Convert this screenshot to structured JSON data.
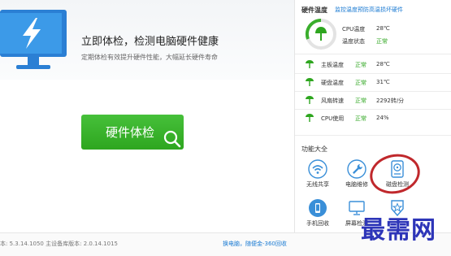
{
  "main": {
    "title": "立即体检，检测电脑硬件健康",
    "subtitle": "定期体检有效提升硬件性能，大幅延长硬件寿命",
    "check_button": "硬件体检"
  },
  "hardware_temp": {
    "title": "硬件温度",
    "link": "监控温度预防高温损坏硬件",
    "gauge_rows": [
      {
        "label": "CPU温度",
        "value": "28℃"
      },
      {
        "label": "温度状态",
        "value": "正常"
      }
    ],
    "rows": [
      {
        "label": "主板温度",
        "status": "正常",
        "value": "28℃"
      },
      {
        "label": "硬盘温度",
        "status": "正常",
        "value": "31℃"
      },
      {
        "label": "风扇转速",
        "status": "正常",
        "value": "2292转/分"
      },
      {
        "label": "CPU使用",
        "status": "正常",
        "value": "24%"
      }
    ]
  },
  "functions": {
    "title": "功能大全",
    "items": [
      {
        "label": "无线共享",
        "icon": "wifi-icon"
      },
      {
        "label": "电脑维修",
        "icon": "wrench-icon"
      },
      {
        "label": "磁盘检测",
        "icon": "disk-icon"
      },
      {
        "label": "手机回收",
        "icon": "phone-recycle-icon"
      },
      {
        "label": "屏幕检测",
        "icon": "monitor-icon"
      },
      {
        "label": "",
        "icon": "star-badge-icon"
      }
    ]
  },
  "status_bar": {
    "version": "本: 5.3.14.1050  主设备库版本: 2.0.14.1015",
    "link": "换电脑，随便金-360回收"
  },
  "watermark": "最需网",
  "colors": {
    "accent": "#2ea61f",
    "link": "#1a7ad2",
    "highlight": "#c0282c",
    "watermark": "#2d35b8"
  }
}
